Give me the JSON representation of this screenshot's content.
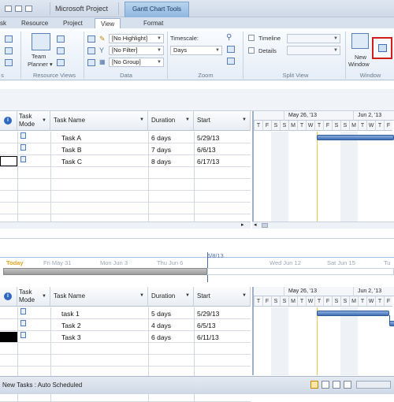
{
  "title": {
    "app": "Microsoft Project",
    "context_tab": "Gantt Chart Tools"
  },
  "tabs": [
    {
      "label": "sk"
    },
    {
      "label": "Resource"
    },
    {
      "label": "Project"
    },
    {
      "label": "View"
    },
    {
      "label": "Format"
    }
  ],
  "ribbon": {
    "team_planner": "Team",
    "team_planner_2": "Planner ▾",
    "highlight": "[No Highlight]",
    "filter": "[No Filter]",
    "group": "[No Group]",
    "timescale_label": "Timescale:",
    "timescale_value": "Days",
    "timeline": "Timeline",
    "details": "Details",
    "new_window": "New",
    "new_window_2": "Window",
    "groups": {
      "views": "s",
      "resource_views": "Resource Views",
      "data": "Data",
      "zoom": "Zoom",
      "split_view": "Split View",
      "window": "Window"
    }
  },
  "upper": {
    "headers": {
      "info": "i",
      "mode": "Task",
      "mode2": "Mode",
      "name": "Task Name",
      "duration": "Duration",
      "start": "Start"
    },
    "tasks": [
      {
        "name": "Task A",
        "duration": "6 days",
        "start": "5/29/13"
      },
      {
        "name": "Task B",
        "duration": "7 days",
        "start": "6/6/13"
      },
      {
        "name": "Task C",
        "duration": "8 days",
        "start": "6/17/13"
      }
    ],
    "week1": "May 26, '13",
    "week2": "Jun 2, '13",
    "days": [
      "T",
      "F",
      "S",
      "S",
      "M",
      "T",
      "W",
      "T",
      "F",
      "S",
      "S",
      "M",
      "T",
      "W",
      "T",
      "F"
    ]
  },
  "timeline": {
    "today": "Today",
    "dates": [
      "Fri May 31",
      "Mon Jun 3",
      "Thu Jun 6",
      "Wed Jun 12",
      "Sat Jun 15",
      "Tu"
    ],
    "marker": "6/8/13"
  },
  "lower": {
    "tasks": [
      {
        "name": "task 1",
        "duration": "5 days",
        "start": "5/29/13"
      },
      {
        "name": "Task 2",
        "duration": "4 days",
        "start": "6/5/13"
      },
      {
        "name": "Task 3",
        "duration": "6 days",
        "start": "6/11/13"
      }
    ]
  },
  "status": {
    "text": "New Tasks : Auto Scheduled"
  }
}
